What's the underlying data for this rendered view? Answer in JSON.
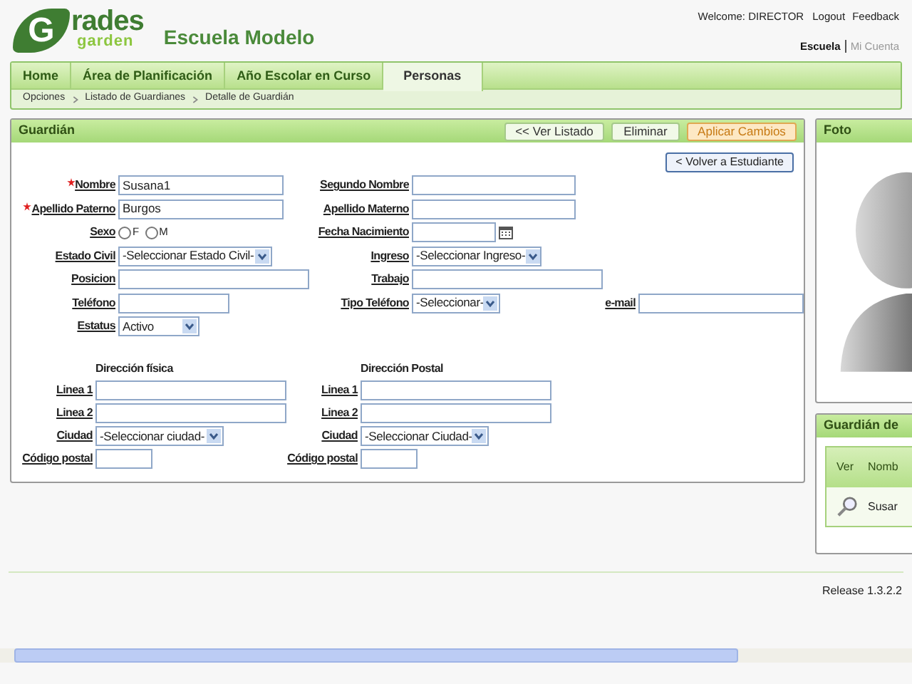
{
  "header": {
    "logo": {
      "letter": "G",
      "rest": "rades",
      "sub": "garden"
    },
    "school": "Escuela Modelo",
    "welcome": "Welcome: DIRECTOR",
    "links": [
      "Logout",
      "Feedback"
    ],
    "context_links": [
      {
        "label": "Escuela",
        "selected": true
      },
      {
        "label": "Mi Cuenta",
        "selected": false
      }
    ]
  },
  "nav": {
    "tabs": [
      {
        "label": "Home",
        "selected": false
      },
      {
        "label": "Área de Planificación",
        "selected": false
      },
      {
        "label": "Año Escolar en Curso",
        "selected": false
      },
      {
        "label": "Personas",
        "selected": true
      }
    ],
    "breadcrumb": [
      "Opciones",
      "Listado de Guardianes",
      "Detalle de Guardián"
    ]
  },
  "panel": {
    "title": "Guardián",
    "actions": [
      {
        "label": "<< Ver Listado",
        "kind": "normal"
      },
      {
        "label": "Eliminar",
        "kind": "normal"
      },
      {
        "label": "Aplicar Cambios",
        "kind": "primary"
      }
    ],
    "back_button": "< Volver a Estudiante",
    "rows": [
      [
        {
          "label": "Nombre",
          "required": true,
          "kind": "text",
          "value": "Susana1"
        },
        {
          "label": "Segundo Nombre",
          "required": false,
          "kind": "text"
        }
      ],
      [
        {
          "label": "Apellido Paterno",
          "required": true,
          "kind": "text",
          "value": "Burgos"
        },
        {
          "label": "Apellido Materno",
          "required": false,
          "kind": "text"
        }
      ],
      [
        {
          "label": "Sexo",
          "required": false,
          "kind": "radio",
          "options": [
            {
              "label": "F",
              "selected": false
            },
            {
              "label": "M",
              "selected": false
            }
          ]
        },
        {
          "label": "Fecha Nacimiento",
          "required": false,
          "kind": "date"
        }
      ],
      [
        {
          "label": "Estado Civil",
          "required": false,
          "kind": "select",
          "value": "-Seleccionar Estado Civil-"
        },
        {
          "label": "Ingreso",
          "required": false,
          "kind": "select",
          "value": "-Seleccionar Ingreso-"
        }
      ],
      [
        {
          "label": "Posicion",
          "required": false,
          "kind": "text"
        },
        {
          "label": "Trabajo",
          "required": false,
          "kind": "text"
        }
      ],
      [
        {
          "label": "Teléfono",
          "required": false,
          "kind": "text"
        },
        {
          "label": "Tipo Teléfono",
          "required": false,
          "kind": "select",
          "value": "-Seleccionar-"
        },
        {
          "label": "e-mail",
          "required": false,
          "kind": "text"
        }
      ],
      [
        {
          "label": "Estatus",
          "required": false,
          "kind": "select",
          "value": "Activo"
        }
      ]
    ],
    "addresses": [
      {
        "heading": "Dirección física",
        "fields": [
          {
            "label": "Linea 1",
            "kind": "text"
          },
          {
            "label": "Linea 2",
            "kind": "text"
          },
          {
            "label": "Ciudad",
            "kind": "select",
            "value": "-Seleccionar ciudad-"
          },
          {
            "label": "Código postal",
            "kind": "text"
          }
        ]
      },
      {
        "heading": "Dirección Postal",
        "fields": [
          {
            "label": "Linea 1",
            "kind": "text"
          },
          {
            "label": "Linea 2",
            "kind": "text"
          },
          {
            "label": "Ciudad",
            "kind": "select",
            "value": "-Seleccionar Ciudad-"
          },
          {
            "label": "Código postal",
            "kind": "text"
          }
        ]
      }
    ]
  },
  "photo_panel": {
    "title": "Foto"
  },
  "guardian_panel": {
    "title": "Guardián de",
    "columns": [
      "Ver",
      "Nomb"
    ],
    "rows": [
      {
        "name": "Susar"
      }
    ]
  },
  "footer": {
    "release": "Release 1.3.2.2"
  }
}
